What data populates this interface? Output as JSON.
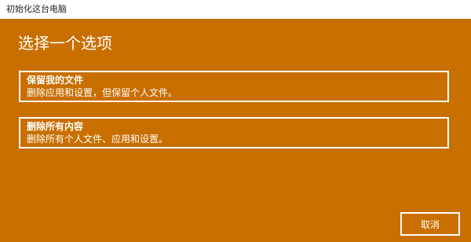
{
  "window": {
    "title": "初始化这台电脑"
  },
  "main": {
    "heading": "选择一个选项",
    "options": [
      {
        "title": "保留我的文件",
        "description": "删除应用和设置，但保留个人文件。"
      },
      {
        "title": "删除所有内容",
        "description": "删除所有个人文件、应用和设置。"
      }
    ],
    "cancel_label": "取消"
  },
  "colors": {
    "background": "#c96f00",
    "titlebar": "#ffffff",
    "text": "#ffffff"
  }
}
